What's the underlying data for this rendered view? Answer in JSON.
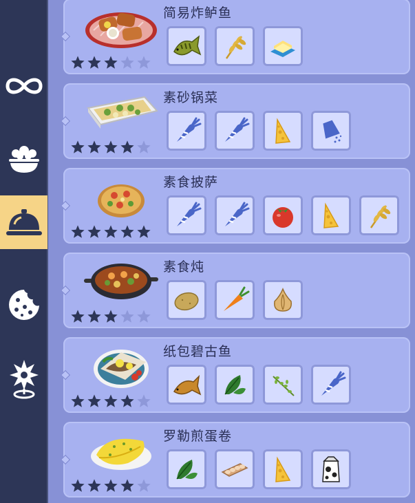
{
  "sidebar": {
    "items": [
      {
        "name": "infinity-icon",
        "active": false
      },
      {
        "name": "salad-bowl-icon",
        "active": false
      },
      {
        "name": "cloche-icon",
        "active": true
      },
      {
        "name": "cookie-icon",
        "active": false
      },
      {
        "name": "sparkle-pin-icon",
        "active": false
      }
    ]
  },
  "recipes": [
    {
      "title": "简易炸鲈鱼",
      "stars": 3,
      "dish_icon": "fried-fish-dish",
      "ingredients": [
        "perch-icon",
        "wheat-icon",
        "butter-icon"
      ]
    },
    {
      "title": "素砂锅菜",
      "stars": 4,
      "dish_icon": "casserole-dish",
      "ingredients": [
        "vegetable-icon",
        "vegetable-icon",
        "cheese-icon",
        "salt-icon"
      ]
    },
    {
      "title": "素食披萨",
      "stars": 5,
      "dish_icon": "pizza-dish",
      "ingredients": [
        "vegetable-icon",
        "vegetable-icon",
        "tomato-icon",
        "cheese-icon",
        "wheat-icon"
      ]
    },
    {
      "title": "素食炖",
      "stars": 3,
      "dish_icon": "stew-dish",
      "ingredients": [
        "potato-icon",
        "carrot-icon",
        "onion-icon"
      ]
    },
    {
      "title": "纸包碧古鱼",
      "stars": 4,
      "dish_icon": "papillote-fish-dish",
      "ingredients": [
        "fish-icon",
        "basil-icon",
        "herb-icon",
        "vegetable-icon"
      ]
    },
    {
      "title": "罗勒煎蛋卷",
      "stars": 4,
      "dish_icon": "omelette-dish",
      "ingredients": [
        "basil-icon",
        "eggs-icon",
        "cheese-icon",
        "milk-icon"
      ]
    }
  ],
  "colors": {
    "card": "#a7b1f0",
    "star_filled": "#2d3657",
    "star_empty": "#8e98d9"
  }
}
